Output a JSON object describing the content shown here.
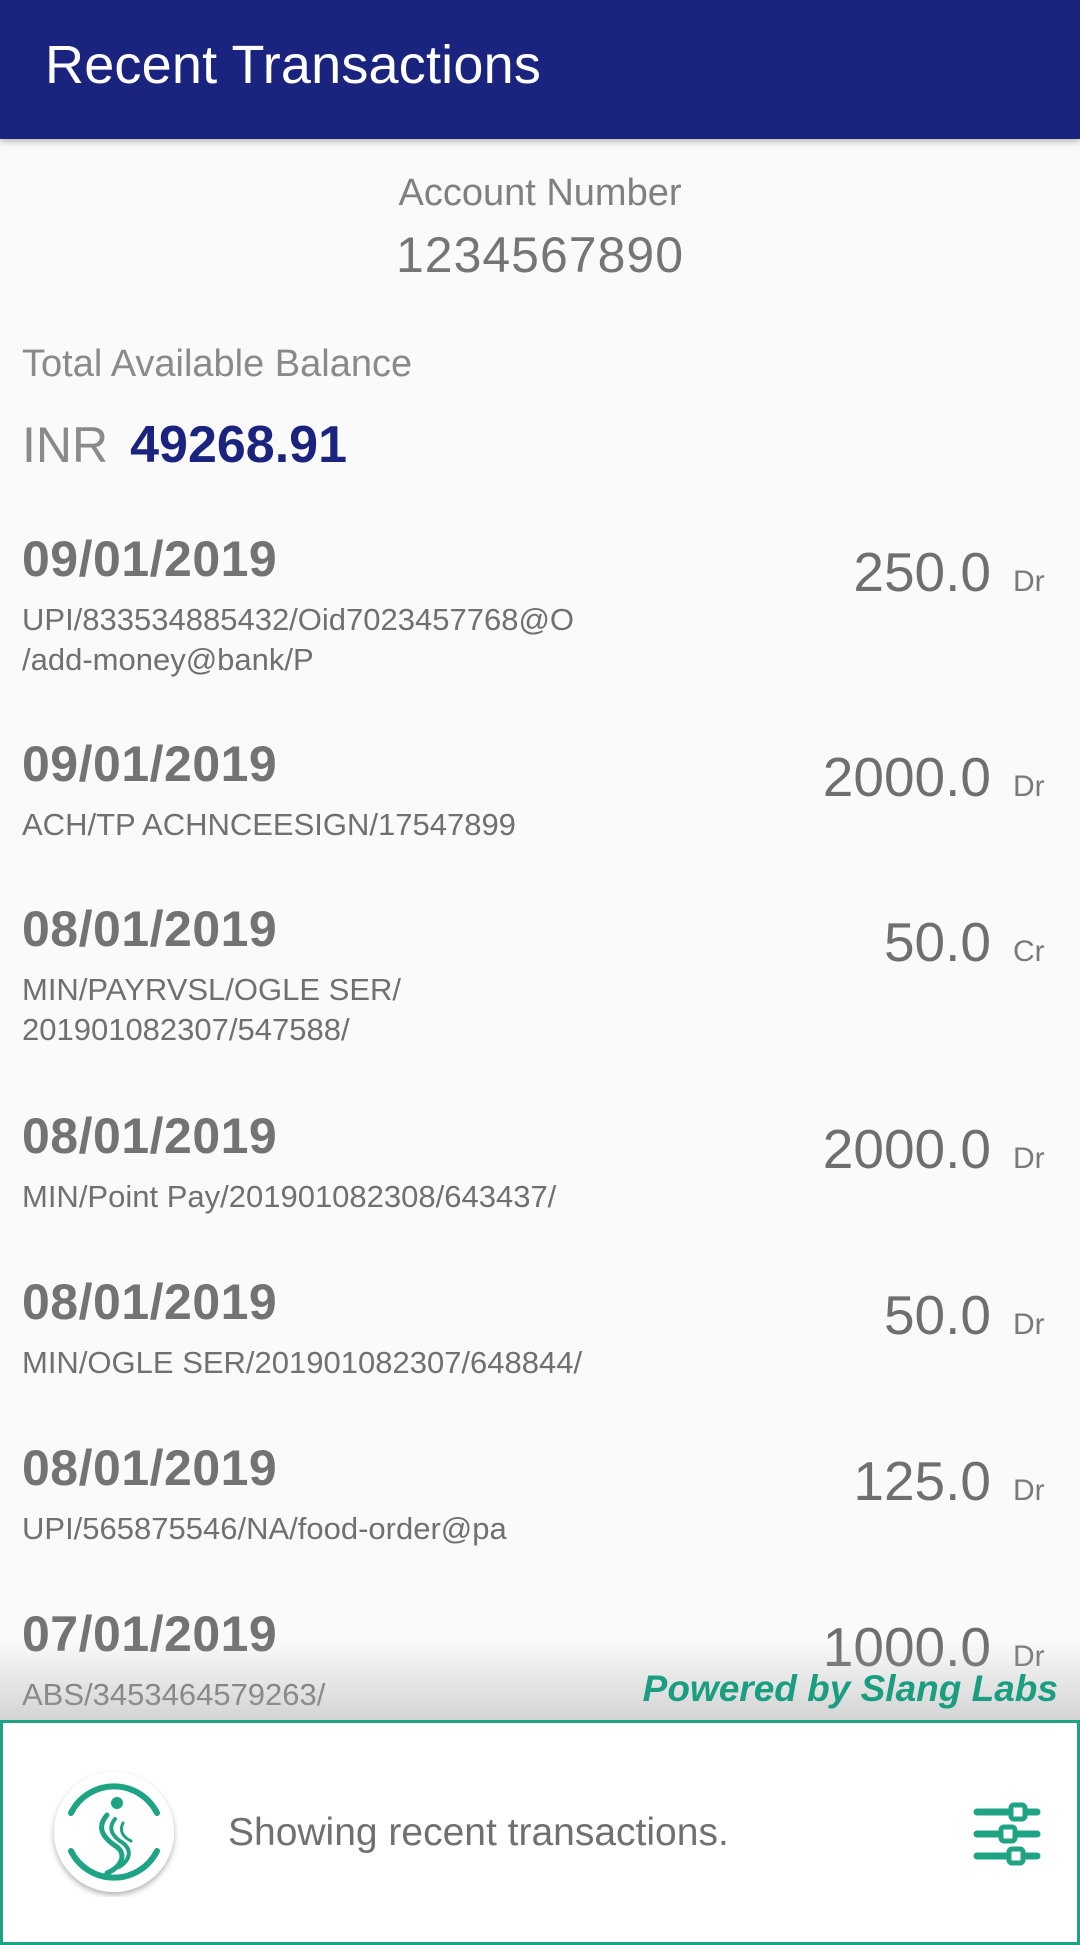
{
  "app_bar": {
    "title": "Recent Transactions"
  },
  "account": {
    "label": "Account Number",
    "number": "1234567890"
  },
  "balance": {
    "label": "Total Available Balance",
    "currency": "INR",
    "amount": "49268.91"
  },
  "transactions": [
    {
      "date": "09/01/2019",
      "desc_lines": [
        "UPI/833534885432/Oid7023457768@O",
        "/add-money@bank/P"
      ],
      "amount": "250.0",
      "type": "Dr"
    },
    {
      "date": "09/01/2019",
      "desc_lines": [
        "ACH/TP ACHNCEESIGN/17547899"
      ],
      "amount": "2000.0",
      "type": "Dr"
    },
    {
      "date": "08/01/2019",
      "desc_lines": [
        "MIN/PAYRVSL/OGLE  SER/",
        "201901082307/547588/"
      ],
      "amount": "50.0",
      "type": "Cr"
    },
    {
      "date": "08/01/2019",
      "desc_lines": [
        "MIN/Point Pay/201901082308/643437/"
      ],
      "amount": "2000.0",
      "type": "Dr"
    },
    {
      "date": "08/01/2019",
      "desc_lines": [
        "MIN/OGLE  SER/201901082307/648844/"
      ],
      "amount": "50.0",
      "type": "Dr"
    },
    {
      "date": "08/01/2019",
      "desc_lines": [
        "UPI/565875546/NA/food-order@pa"
      ],
      "amount": "125.0",
      "type": "Dr"
    },
    {
      "date": "07/01/2019",
      "desc_lines": [
        "ABS/3453464579263/"
      ],
      "amount": "1000.0",
      "type": "Dr"
    }
  ],
  "branding": {
    "powered_by": "Powered by Slang Labs"
  },
  "assistant": {
    "message": "Showing recent transactions.",
    "logo_icon": "slang-logo-icon",
    "settings_icon": "sliders-icon"
  },
  "colors": {
    "app_bar": "#1a237e",
    "balance_amount": "#1a237e",
    "brand_green": "#1fa385",
    "background": "#fafafa"
  }
}
